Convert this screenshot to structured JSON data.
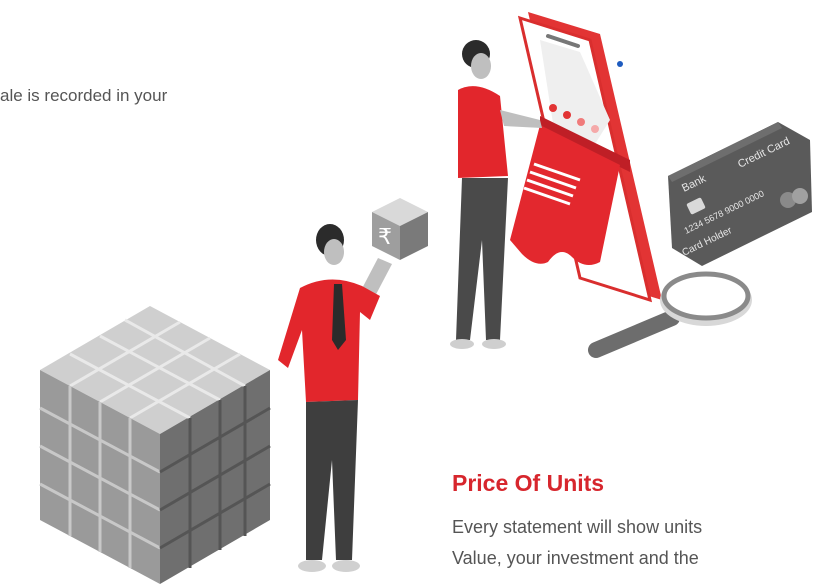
{
  "intro": {
    "text": "ale is recorded in your"
  },
  "feature": {
    "title": "Price Of Units",
    "body_lines": [
      "Every statement will show units",
      "Value, your investment and the"
    ]
  },
  "card": {
    "title": "Credit Card",
    "bank": "Bank",
    "number": "1234  5678  9000  0000",
    "holder": "Card Holder"
  },
  "currency_symbol": "₹",
  "colors": {
    "accent": "#d7262d",
    "text": "#555555",
    "card": "#5a5a5a"
  },
  "icons": [
    "phone-icon",
    "credit-card-icon",
    "magnifier-icon",
    "cube-icon",
    "rupee-box-icon",
    "person-illustration"
  ]
}
